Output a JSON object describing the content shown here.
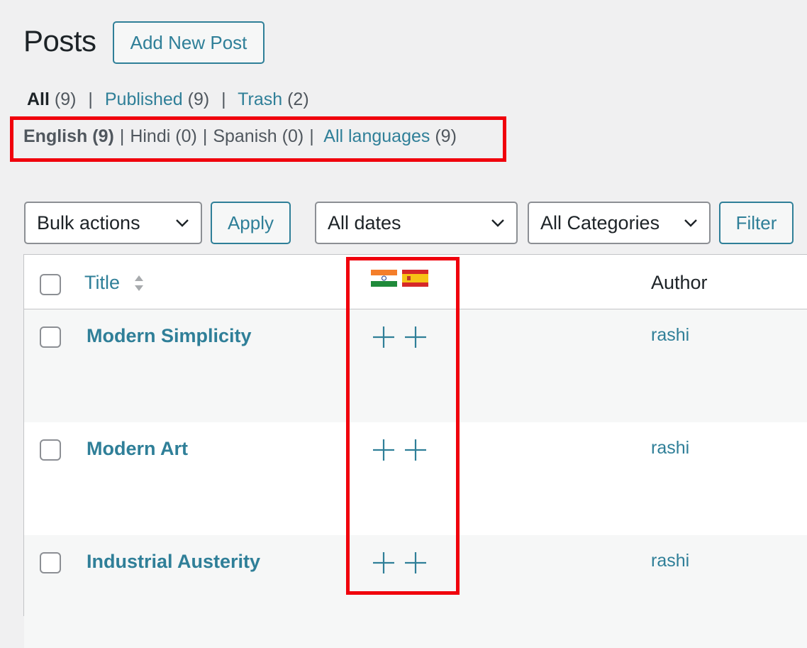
{
  "page": {
    "title": "Posts",
    "add_new_label": "Add New Post"
  },
  "status_filters": [
    {
      "label": "All",
      "count": "(9)",
      "current": true
    },
    {
      "label": "Published",
      "count": "(9)"
    },
    {
      "label": "Trash",
      "count": "(2)"
    }
  ],
  "language_filters": [
    {
      "label": "English",
      "count": "(9)",
      "current": true
    },
    {
      "label": "Hindi",
      "count": "(0)"
    },
    {
      "label": "Spanish",
      "count": "(0)"
    },
    {
      "label": "All languages",
      "count": "(9)"
    }
  ],
  "toolbar": {
    "bulk_actions": "Bulk actions",
    "apply_label": "Apply",
    "dates": "All dates",
    "categories": "All Categories",
    "filter_label": "Filter"
  },
  "table": {
    "columns": {
      "title": "Title",
      "author": "Author",
      "language_flags": [
        "india-flag-icon",
        "spain-flag-icon"
      ]
    },
    "rows": [
      {
        "title": "Modern Simplicity",
        "author": "rashi"
      },
      {
        "title": "Modern Art",
        "author": "rashi"
      },
      {
        "title": "Industrial Austerity",
        "author": "rashi"
      }
    ]
  },
  "colors": {
    "link": "#2f7f98",
    "highlight": "#f0000c",
    "background": "#f0f0f1",
    "text": "#1d2327"
  }
}
